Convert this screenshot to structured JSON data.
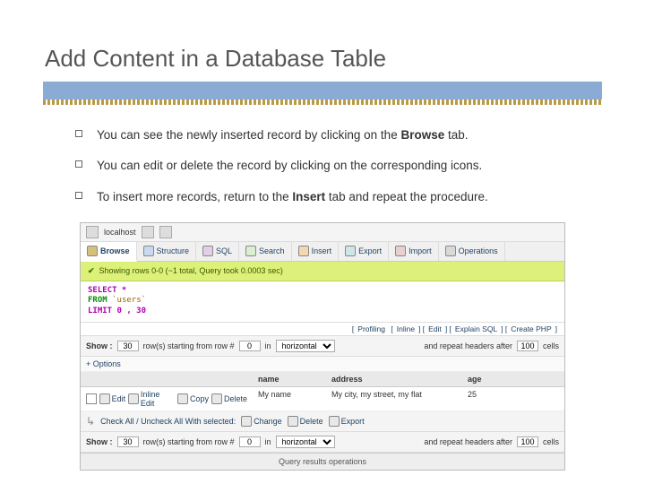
{
  "title": "Add Content in a Database Table",
  "bullets": [
    {
      "pre": "You can see the newly inserted record by clicking on the ",
      "bold": "Browse",
      "post": " tab."
    },
    {
      "pre": "You can edit or delete the record by clicking on the corresponding icons.",
      "bold": "",
      "post": ""
    },
    {
      "pre": "To insert more records, return to the ",
      "bold": "Insert",
      "post": " tab and repeat the procedure."
    }
  ],
  "screenshot": {
    "breadcrumb": {
      "host": "localhost",
      "db": "",
      "table": ""
    },
    "tabs": [
      "Browse",
      "Structure",
      "SQL",
      "Search",
      "Insert",
      "Export",
      "Import",
      "Operations"
    ],
    "status": "Showing rows 0-0 (~1 total, Query took 0.0003 sec)",
    "sql": {
      "select": "SELECT *",
      "from": "FROM",
      "table": "`users`",
      "limit": "LIMIT 0 , 30"
    },
    "links": [
      "Profiling",
      "Inline",
      "Edit",
      "Explain SQL",
      "Create PHP"
    ],
    "show": {
      "label": "Show :",
      "rows_value": "30",
      "rows_text": "row(s) starting from row #",
      "start_value": "0",
      "mode": "horizontal",
      "repeat_text": "and repeat headers after",
      "repeat_value": "100",
      "cells": "cells"
    },
    "options": "+ Options",
    "columns": [
      "name",
      "address",
      "age"
    ],
    "row": {
      "actions": [
        "Edit",
        "Inline Edit",
        "Copy",
        "Delete"
      ],
      "name": "My name",
      "address": "My city, my street, my flat",
      "age": "25"
    },
    "checkall": {
      "label": "Check All / Uncheck All With selected:",
      "actions": [
        "Change",
        "Delete",
        "Export"
      ]
    },
    "footer": "Query results operations"
  }
}
